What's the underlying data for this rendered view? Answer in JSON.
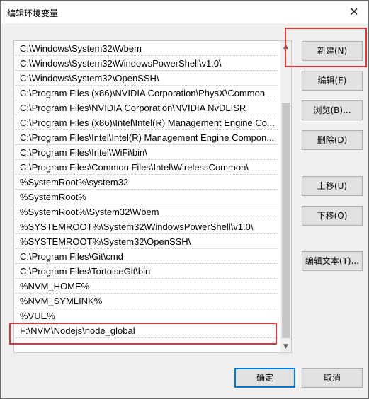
{
  "window": {
    "title": "编辑环境变量",
    "close_glyph": "✕"
  },
  "list": {
    "items": [
      "C:\\Windows\\System32\\Wbem",
      "C:\\Windows\\System32\\WindowsPowerShell\\v1.0\\",
      "C:\\Windows\\System32\\OpenSSH\\",
      "C:\\Program Files (x86)\\NVIDIA Corporation\\PhysX\\Common",
      "C:\\Program Files\\NVIDIA Corporation\\NVIDIA NvDLISR",
      "C:\\Program Files (x86)\\Intel\\Intel(R) Management Engine Co...",
      "C:\\Program Files\\Intel\\Intel(R) Management Engine Compon...",
      "C:\\Program Files\\Intel\\WiFi\\bin\\",
      "C:\\Program Files\\Common Files\\Intel\\WirelessCommon\\",
      "%SystemRoot%\\system32",
      "%SystemRoot%",
      "%SystemRoot%\\System32\\Wbem",
      "%SYSTEMROOT%\\System32\\WindowsPowerShell\\v1.0\\",
      "%SYSTEMROOT%\\System32\\OpenSSH\\",
      "C:\\Program Files\\Git\\cmd",
      "C:\\Program Files\\TortoiseGit\\bin",
      "%NVM_HOME%",
      "%NVM_SYMLINK%",
      "%VUE%",
      "F:\\NVM\\Nodejs\\node_global"
    ],
    "scroll_up": "▲",
    "scroll_down": "▼"
  },
  "buttons": {
    "new": "新建(N)",
    "edit": "编辑(E)",
    "browse": "浏览(B)...",
    "delete": "删除(D)",
    "move_up": "上移(U)",
    "move_down": "下移(O)",
    "edit_text": "编辑文本(T)...",
    "ok": "确定",
    "cancel": "取消"
  },
  "colors": {
    "highlight": "#e23636",
    "focus": "#0078d7"
  }
}
